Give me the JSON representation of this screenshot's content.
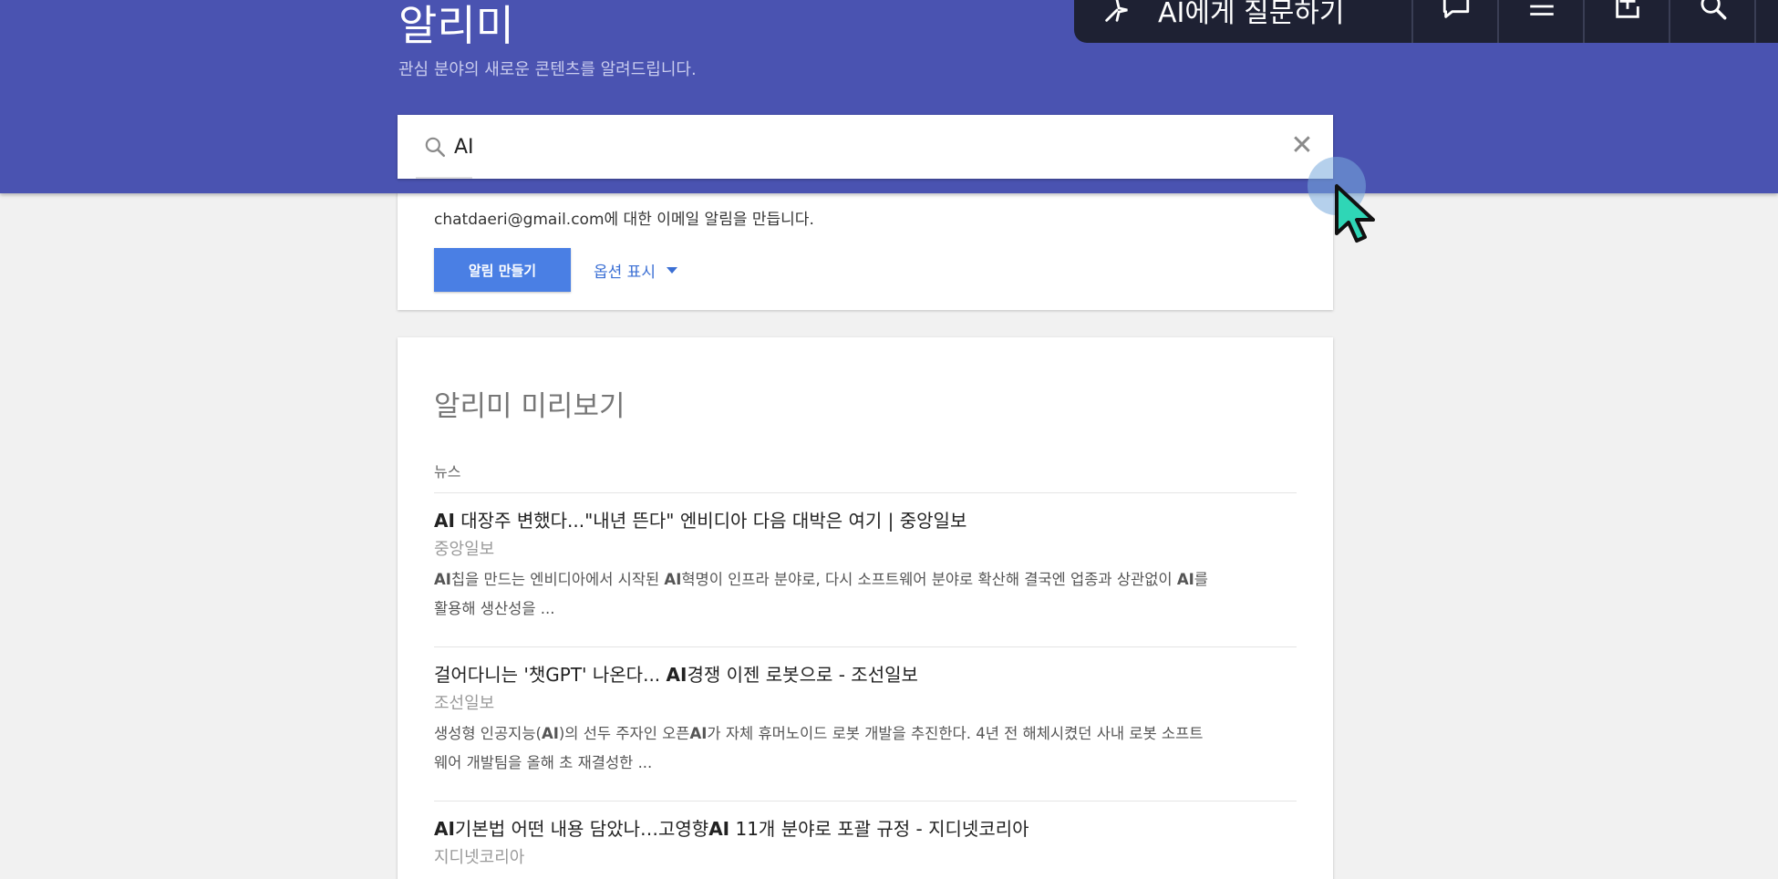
{
  "header": {
    "title": "알리미",
    "subtitle": "관심 분야의 새로운 콘텐츠를 알려드립니다."
  },
  "search": {
    "value": "AI",
    "clear_symbol": "✕"
  },
  "toolbar": {
    "ai_label": "AI에게 질문하기",
    "icons": [
      "spark-icon",
      "chat-icon",
      "menu-icon",
      "add-window-icon",
      "search-icon"
    ]
  },
  "create_alert": {
    "description": "chatdaeri@gmail.com에 대한 이메일 알림을 만듭니다.",
    "button_label": "알림 만들기",
    "options_label": "옵션 표시"
  },
  "preview": {
    "title": "알리미 미리보기",
    "section_label": "뉴스",
    "items": [
      {
        "title": "AI 대장주 변했다...\"내년 뜬다\" 엔비디아 다음 대박은 여기 | 중앙일보",
        "source": "중앙일보",
        "snippet_1": "AI칩을 만드는 엔비디아에서 시작된 AI혁명이 인프라 분야로, 다시 소프트웨어 분야로 확산해 결국엔 업종과 상관없이 AI를",
        "snippet_2": "활용해 생산성을 ..."
      },
      {
        "title": "걸어다니는 '챗GPT' 나온다... AI경쟁 이젠 로봇으로 - 조선일보",
        "source": "조선일보",
        "snippet_1": "생성형 인공지능(AI)의 선두 주자인 오픈AI가 자체 휴머노이드 로봇 개발을 추진한다. 4년 전 해체시켰던 사내 로봇 소프트",
        "snippet_2": "웨어 개발팀을 올해 초 재결성한 ..."
      },
      {
        "title": "AI기본법 어떤 내용 담았나…고영향AI 11개 분야로 포괄 규정 - 지디넷코리아",
        "source": "지디넷코리아"
      }
    ]
  },
  "colors": {
    "header_bg": "#4a53b1",
    "toolbar_bg": "#1e2133",
    "button_bg": "#4a7fe4",
    "link": "#3b6fd4"
  }
}
